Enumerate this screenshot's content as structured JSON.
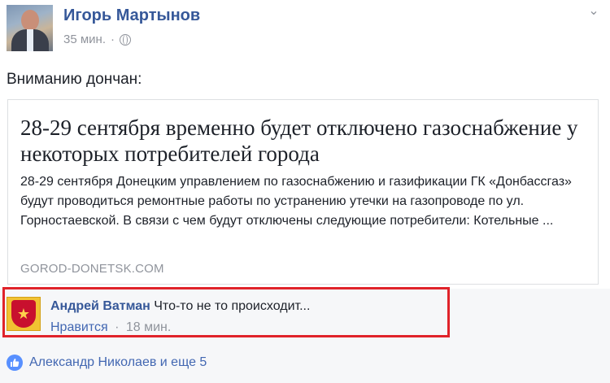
{
  "post": {
    "author": "Игорь Мартынов",
    "time": "35 мин.",
    "dot": "·",
    "text": "Вниманию дончан:"
  },
  "icons": {
    "privacy": "globe-icon",
    "menu": "chevron-down-icon",
    "reactions": "like-icon"
  },
  "card": {
    "title": "28-29 сентября временно будет отключено газоснабжение у некоторых потребителей города",
    "description": "28-29 сентября Донецким управлением по газоснабжению и газификации ГК «Донбассгаз» будут проводиться ремонтные работы по устранению утечки на газопроводе по ул. Горностаевской. В связи с чем будут отключены следующие потребители: Котельные ...",
    "domain": "GOROD-DONETSK.COM"
  },
  "comment": {
    "author": "Андрей Ватман",
    "text": "Что-то не то происходит...",
    "like_label": "Нравится",
    "dot": "·",
    "time": "18 мин."
  },
  "likes": {
    "text": "Александр Николаев и еще 5"
  },
  "colors": {
    "link": "#365899",
    "muted": "#90949c",
    "highlight": "#e0232a",
    "like_blue": "#5890ff"
  }
}
